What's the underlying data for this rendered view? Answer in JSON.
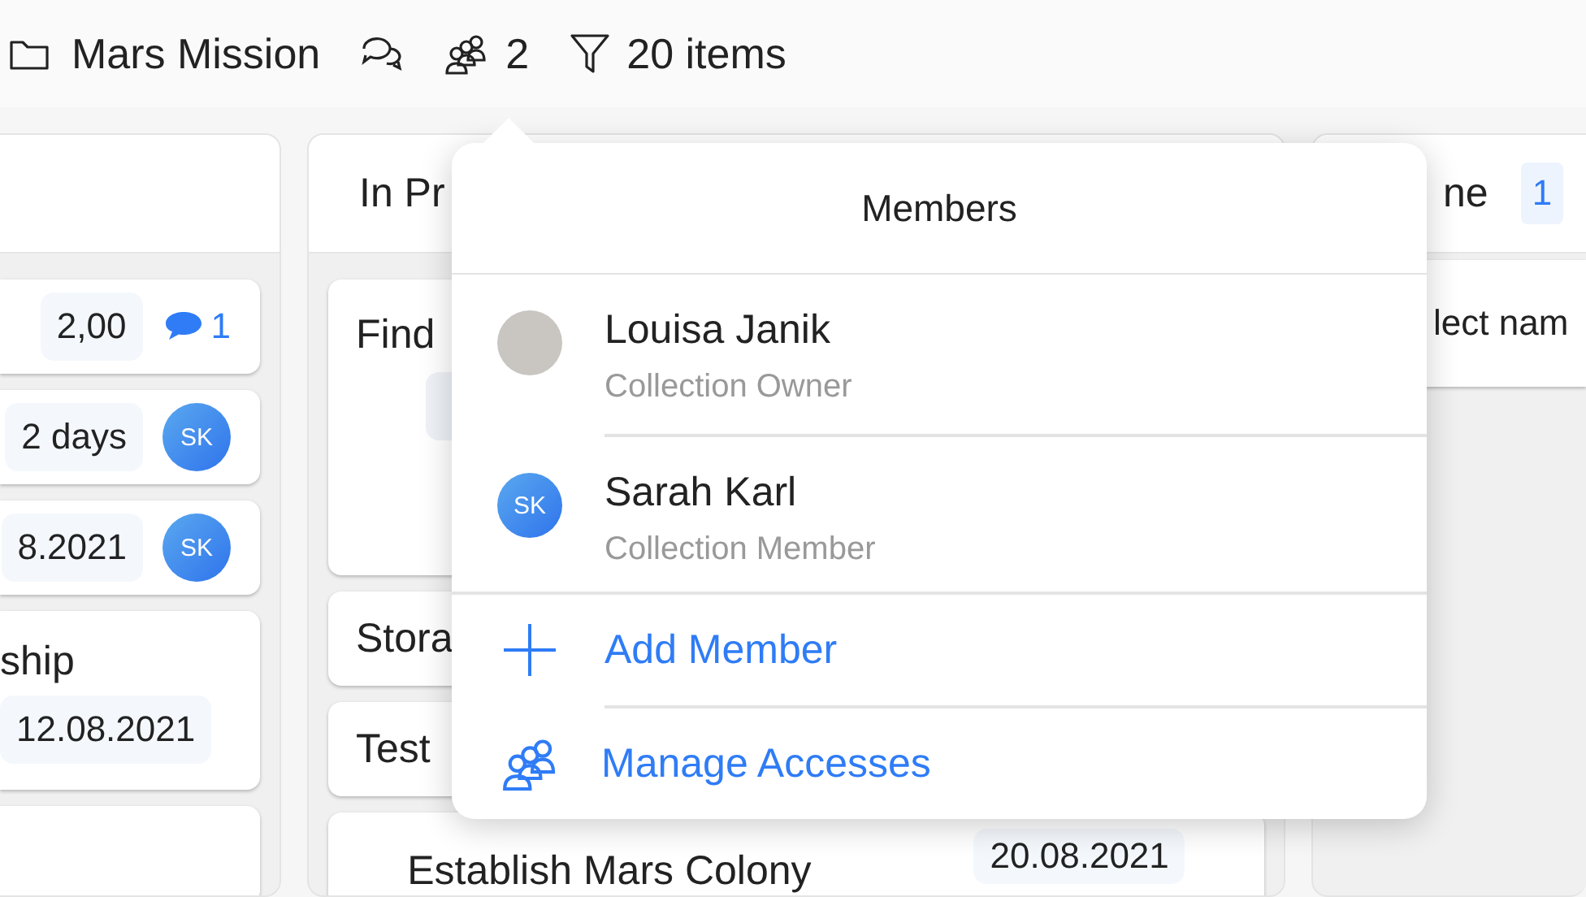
{
  "breadcrumb": {
    "folder": "Mars Mission",
    "members_count": "2",
    "filter": "20 items"
  },
  "columns": [
    {
      "cards": [
        {
          "kind": "task",
          "chips": [
            "2,00"
          ],
          "comments": "1"
        },
        {
          "kind": "task",
          "chips": [
            "2 days"
          ],
          "avatar": "SK"
        },
        {
          "kind": "task",
          "chips": [
            "8.2021"
          ],
          "avatar": "SK"
        },
        {
          "kind": "task",
          "title": "ship",
          "chips": [
            "12.08.2021"
          ]
        },
        {
          "kind": "blank"
        }
      ]
    },
    {
      "header": "In Pr",
      "cards": [
        {
          "kind": "task",
          "title": "Find",
          "blank_chip": true
        },
        {
          "kind": "task",
          "title": "Stora"
        },
        {
          "kind": "task",
          "title": "Test"
        },
        {
          "kind": "task",
          "title": "Establish Mars Colony",
          "chips": [
            "20.08.2021"
          ]
        }
      ]
    },
    {
      "header": "ne",
      "count": "1",
      "cards": [
        {
          "kind": "task",
          "title": "lect nam"
        }
      ]
    }
  ],
  "popover": {
    "title": "Members",
    "members": [
      {
        "name": "Louisa Janik",
        "role": "Collection Owner",
        "has_photo": true
      },
      {
        "name": "Sarah Karl",
        "role": "Collection Member",
        "has_photo": false,
        "initials": "SK"
      }
    ],
    "actions": [
      {
        "kind": "add",
        "label": "Add Member"
      },
      {
        "kind": "manage",
        "label": "Manage Accesses"
      }
    ]
  }
}
